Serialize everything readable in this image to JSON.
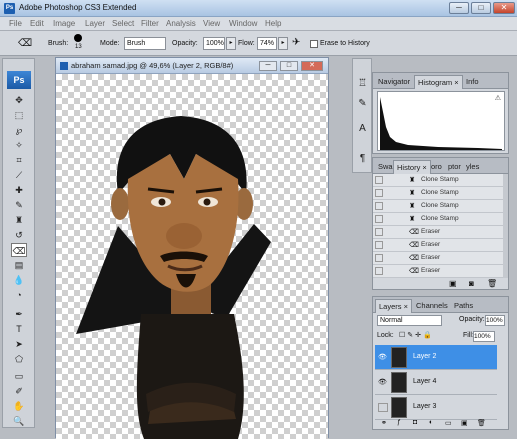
{
  "app": {
    "title": "Adobe Photoshop CS3 Extended",
    "icon": "Ps",
    "window_buttons": [
      "─",
      "□",
      "✕"
    ]
  },
  "menu": [
    "File",
    "Edit",
    "Image",
    "Layer",
    "Select",
    "Filter",
    "Analysis",
    "View",
    "Window",
    "Help"
  ],
  "options": {
    "brush_label": "Brush:",
    "brush_size": "13",
    "mode_label": "Mode:",
    "mode_value": "Brush",
    "opacity_label": "Opacity:",
    "opacity_value": "100%",
    "flow_label": "Flow:",
    "flow_value": "74%",
    "erase_to_history_label": "Erase to History"
  },
  "toolbox": {
    "logo": "Ps"
  },
  "document": {
    "title": "abraham samad.jpg @ 49,6% (Layer 2, RGB/8#)"
  },
  "navigator_panel": {
    "tabs": [
      "Navigator",
      "Histogram ×",
      "Info"
    ],
    "active_tab": 1
  },
  "history_panel": {
    "tabs": [
      "Swa",
      "History ×",
      "oro",
      "ptor",
      "yles"
    ],
    "items": [
      {
        "label": "Clone Stamp",
        "icon": "clone-stamp-icon"
      },
      {
        "label": "Clone Stamp",
        "icon": "clone-stamp-icon"
      },
      {
        "label": "Clone Stamp",
        "icon": "clone-stamp-icon"
      },
      {
        "label": "Clone Stamp",
        "icon": "clone-stamp-icon"
      },
      {
        "label": "Eraser",
        "icon": "eraser-icon"
      },
      {
        "label": "Eraser",
        "icon": "eraser-icon"
      },
      {
        "label": "Eraser",
        "icon": "eraser-icon"
      },
      {
        "label": "Eraser",
        "icon": "eraser-icon"
      }
    ]
  },
  "layers_panel": {
    "tabs": [
      "Layers ×",
      "Channels",
      "Paths"
    ],
    "blend_mode": "Normal",
    "opacity_label": "Opacity:",
    "opacity_value": "100%",
    "lock_label": "Lock:",
    "fill_label": "Fill:",
    "fill_value": "100%",
    "layers": [
      {
        "name": "Layer 2",
        "visible": true,
        "selected": true
      },
      {
        "name": "Layer 4",
        "visible": true,
        "selected": false
      },
      {
        "name": "Layer 3",
        "visible": false,
        "selected": false
      }
    ]
  },
  "colors": {
    "accent": "#3e8fe6",
    "panel": "#d3d7dd",
    "titlebar": "#b9cfe8"
  }
}
